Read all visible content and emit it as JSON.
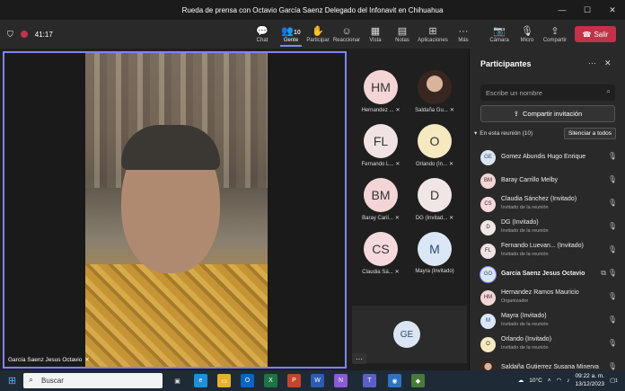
{
  "window": {
    "title": "Rueda de prensa con Octavio García Saenz Delegado del Infonavit en Chihuahua",
    "min": "—",
    "max": "☐",
    "close": "✕"
  },
  "toolbar": {
    "timer": "41:17",
    "buttons": [
      {
        "label": "Chat",
        "icon": "chat-icon"
      },
      {
        "label": "Gente",
        "icon": "people-icon",
        "badge": "10"
      },
      {
        "label": "Participar",
        "icon": "hand-icon"
      },
      {
        "label": "Reaccionar",
        "icon": "emoji-icon"
      },
      {
        "label": "Vista",
        "icon": "grid-icon"
      },
      {
        "label": "Notas",
        "icon": "notes-icon"
      },
      {
        "label": "Aplicaciones",
        "icon": "apps-icon"
      },
      {
        "label": "Más",
        "icon": "more-icon"
      },
      {
        "label": "Cámara",
        "icon": "camera-off-icon"
      },
      {
        "label": "Micro",
        "icon": "mic-off-icon"
      },
      {
        "label": "Compartir",
        "icon": "share-icon"
      }
    ],
    "leave_label": "Salir"
  },
  "main_video": {
    "name": "García Saenz Jesus Octavio"
  },
  "tiles": [
    {
      "initials": "HM",
      "label": "Hernandez ...",
      "color": "#f4d5d5"
    },
    {
      "initials": "",
      "label": "Saldaña Gu...",
      "color": "#6b4a3c"
    },
    {
      "initials": "FL",
      "label": "Fernando L...",
      "color": "#f1e3e3"
    },
    {
      "initials": "O",
      "label": "Orlando (In...",
      "color": "#f6e9c0"
    },
    {
      "initials": "BM",
      "label": "Baray Caril...",
      "color": "#f4d5d5"
    },
    {
      "initials": "D",
      "label": "DG (Invitad...",
      "color": "#f0e6e6"
    },
    {
      "initials": "CS",
      "label": "Claudia Sá...",
      "color": "#f6d9dd"
    },
    {
      "initials": "M",
      "label": "Mayra (Invitado)",
      "color": "#dbe7f6"
    }
  ],
  "overflow_tile": {
    "initials": "GE"
  },
  "panel": {
    "title": "Participantes",
    "search_placeholder": "Escribe un nombre",
    "share_label": "Compartir invitación",
    "section_label": "En esta reunión (10)",
    "mute_all_label": "Silenciar a todos",
    "participants": [
      {
        "initials": "GE",
        "name": "Gomez Abundis Hugo Enrique",
        "sub": "",
        "color": "#dbe5f3"
      },
      {
        "initials": "BM",
        "name": "Baray Carrillo Melby",
        "sub": "",
        "color": "#f4d5d5"
      },
      {
        "initials": "CS",
        "name": "Claudia Sánchez (Invitado)",
        "sub": "Invitado de la reunión",
        "color": "#f6d9dd"
      },
      {
        "initials": "D",
        "name": "DG (Invitado)",
        "sub": "Invitado de la reunión",
        "color": "#f0e6e6"
      },
      {
        "initials": "FL",
        "name": "Fernando Luevan... (Invitado)",
        "sub": "Invitado de la reunión",
        "color": "#f1e3e3"
      },
      {
        "initials": "GO",
        "name": "Garcia Saenz Jesus Octavio",
        "sub": "",
        "color": "#dbe5f3"
      },
      {
        "initials": "HM",
        "name": "Hernandez Ramos Mauricio",
        "sub": "Organizador",
        "color": "#f4d5d5"
      },
      {
        "initials": "M",
        "name": "Mayra (Invitado)",
        "sub": "Invitado de la reunión",
        "color": "#dbe7f6"
      },
      {
        "initials": "O",
        "name": "Orlando (Invitado)",
        "sub": "Invitado de la reunión",
        "color": "#f6e9c0"
      },
      {
        "initials": "",
        "name": "Saldaña Gutierrez Susana Minerva",
        "sub": "",
        "color": "#6b4a3c"
      }
    ]
  },
  "taskbar": {
    "search_label": "Buscar",
    "temperature": "10°C",
    "time": "09:22 a. m.",
    "date": "13/12/2023",
    "notif_count": "1"
  }
}
